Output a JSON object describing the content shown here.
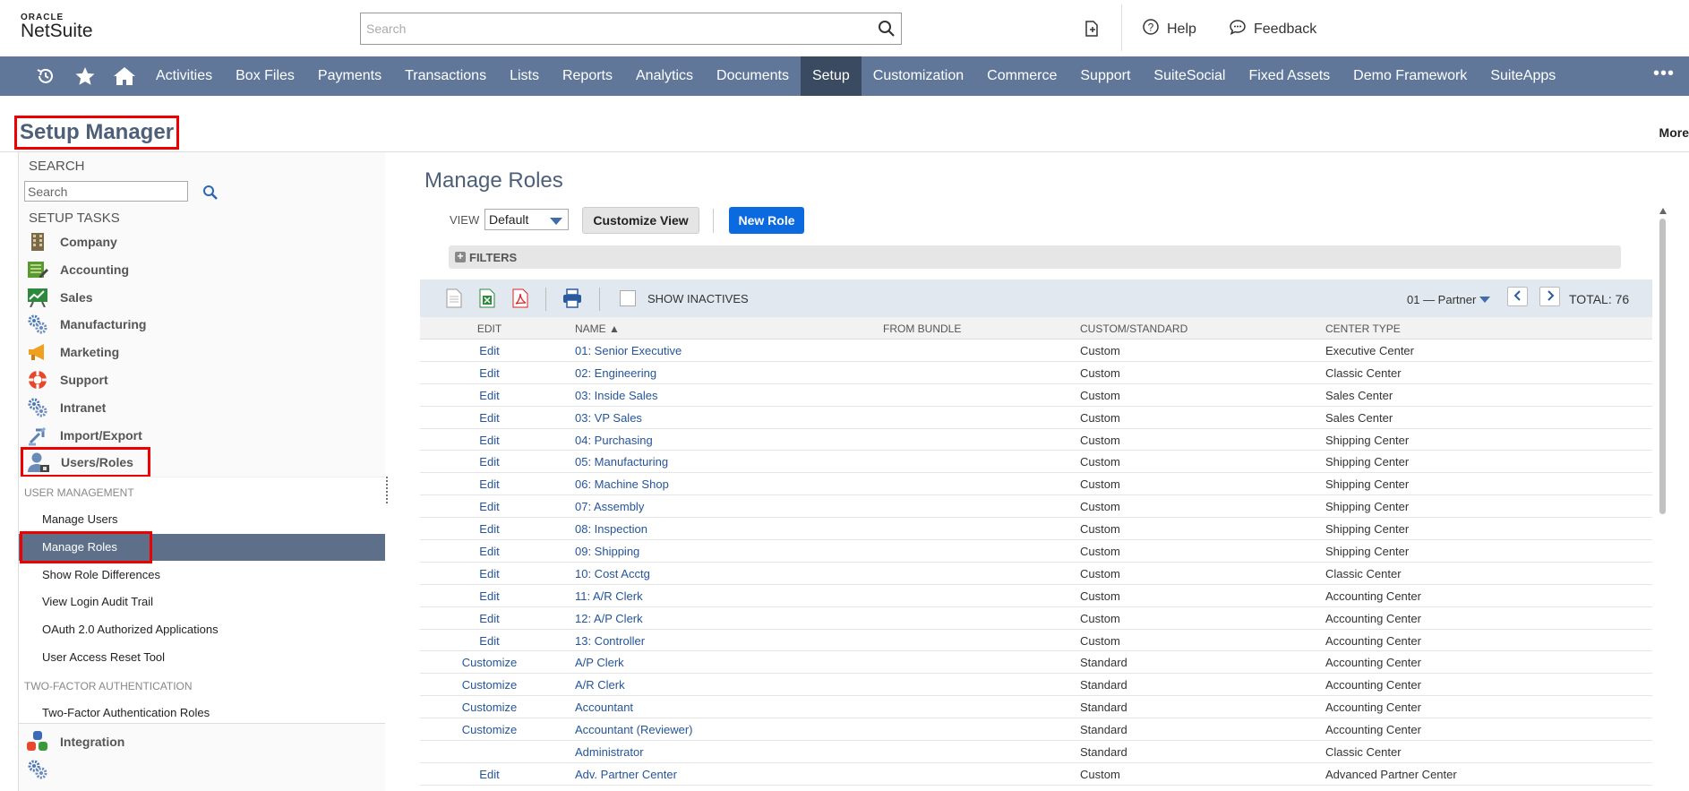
{
  "header": {
    "logo_top": "ORACLE",
    "logo_bottom": "NetSuite",
    "search_placeholder": "Search",
    "help_label": "Help",
    "feedback_label": "Feedback"
  },
  "nav": {
    "items": [
      "Activities",
      "Box Files",
      "Payments",
      "Transactions",
      "Lists",
      "Reports",
      "Analytics",
      "Documents",
      "Setup",
      "Customization",
      "Commerce",
      "Support",
      "SuiteSocial",
      "Fixed Assets",
      "Demo Framework",
      "SuiteApps"
    ],
    "active": "Setup",
    "more": "•••"
  },
  "page": {
    "title": "Setup Manager",
    "more_label": "More"
  },
  "sidebar": {
    "search_heading": "SEARCH",
    "search_placeholder": "Search",
    "tasks_heading": "SETUP TASKS",
    "tasks": [
      {
        "label": "Company",
        "icon": "building-icon"
      },
      {
        "label": "Accounting",
        "icon": "ledger-icon"
      },
      {
        "label": "Sales",
        "icon": "sales-chart-icon"
      },
      {
        "label": "Manufacturing",
        "icon": "gears-icon"
      },
      {
        "label": "Marketing",
        "icon": "megaphone-icon"
      },
      {
        "label": "Support",
        "icon": "lifebuoy-icon"
      },
      {
        "label": "Intranet",
        "icon": "gears-icon"
      },
      {
        "label": "Import/Export",
        "icon": "arrows-icon"
      },
      {
        "label": "Users/Roles",
        "icon": "user-icon"
      }
    ],
    "user_management_heading": "USER MANAGEMENT",
    "user_management_items": [
      "Manage Users",
      "Manage Roles",
      "Show Role Differences",
      "View Login Audit Trail",
      "OAuth 2.0 Authorized Applications",
      "User Access Reset Tool"
    ],
    "two_factor_heading": "TWO-FACTOR AUTHENTICATION",
    "two_factor_items": [
      "Two-Factor Authentication Roles"
    ],
    "integration_label": "Integration"
  },
  "main": {
    "title": "Manage Roles",
    "view_label": "VIEW",
    "view_value": "Default",
    "customize_view_label": "Customize View",
    "new_role_label": "New Role",
    "filters_label": "FILTERS",
    "show_inactives_label": "SHOW INACTIVES",
    "page_selector": "01 — Partner",
    "total_label": "TOTAL: 76",
    "columns": [
      "EDIT",
      "NAME ▲",
      "FROM BUNDLE",
      "CUSTOM/STANDARD",
      "CENTER TYPE"
    ],
    "rows": [
      {
        "edit": "Edit",
        "name": "01: Senior Executive",
        "bundle": "",
        "cs": "Custom",
        "ct": "Executive Center"
      },
      {
        "edit": "Edit",
        "name": "02: Engineering",
        "bundle": "",
        "cs": "Custom",
        "ct": "Classic Center"
      },
      {
        "edit": "Edit",
        "name": "03: Inside Sales",
        "bundle": "",
        "cs": "Custom",
        "ct": "Sales Center"
      },
      {
        "edit": "Edit",
        "name": "03: VP Sales",
        "bundle": "",
        "cs": "Custom",
        "ct": "Sales Center"
      },
      {
        "edit": "Edit",
        "name": "04: Purchasing",
        "bundle": "",
        "cs": "Custom",
        "ct": "Shipping Center"
      },
      {
        "edit": "Edit",
        "name": "05: Manufacturing",
        "bundle": "",
        "cs": "Custom",
        "ct": "Shipping Center"
      },
      {
        "edit": "Edit",
        "name": "06: Machine Shop",
        "bundle": "",
        "cs": "Custom",
        "ct": "Shipping Center"
      },
      {
        "edit": "Edit",
        "name": "07: Assembly",
        "bundle": "",
        "cs": "Custom",
        "ct": "Shipping Center"
      },
      {
        "edit": "Edit",
        "name": "08: Inspection",
        "bundle": "",
        "cs": "Custom",
        "ct": "Shipping Center"
      },
      {
        "edit": "Edit",
        "name": "09: Shipping",
        "bundle": "",
        "cs": "Custom",
        "ct": "Shipping Center"
      },
      {
        "edit": "Edit",
        "name": "10: Cost Acctg",
        "bundle": "",
        "cs": "Custom",
        "ct": "Classic Center"
      },
      {
        "edit": "Edit",
        "name": "11: A/R Clerk",
        "bundle": "",
        "cs": "Custom",
        "ct": "Accounting Center"
      },
      {
        "edit": "Edit",
        "name": "12: A/P Clerk",
        "bundle": "",
        "cs": "Custom",
        "ct": "Accounting Center"
      },
      {
        "edit": "Edit",
        "name": "13: Controller",
        "bundle": "",
        "cs": "Custom",
        "ct": "Accounting Center"
      },
      {
        "edit": "Customize",
        "name": "A/P Clerk",
        "bundle": "",
        "cs": "Standard",
        "ct": "Accounting Center"
      },
      {
        "edit": "Customize",
        "name": "A/R Clerk",
        "bundle": "",
        "cs": "Standard",
        "ct": "Accounting Center"
      },
      {
        "edit": "Customize",
        "name": "Accountant",
        "bundle": "",
        "cs": "Standard",
        "ct": "Accounting Center"
      },
      {
        "edit": "Customize",
        "name": "Accountant (Reviewer)",
        "bundle": "",
        "cs": "Standard",
        "ct": "Accounting Center"
      },
      {
        "edit": "",
        "name": "Administrator",
        "bundle": "",
        "cs": "Standard",
        "ct": "Classic Center"
      },
      {
        "edit": "Edit",
        "name": "Adv. Partner Center",
        "bundle": "",
        "cs": "Custom",
        "ct": "Advanced Partner Center"
      }
    ]
  },
  "colors": {
    "nav_bg": "#607799",
    "nav_active": "#3a4a60",
    "link": "#255599",
    "highlight_box": "#e00000",
    "primary_button": "#0c6ae0"
  }
}
